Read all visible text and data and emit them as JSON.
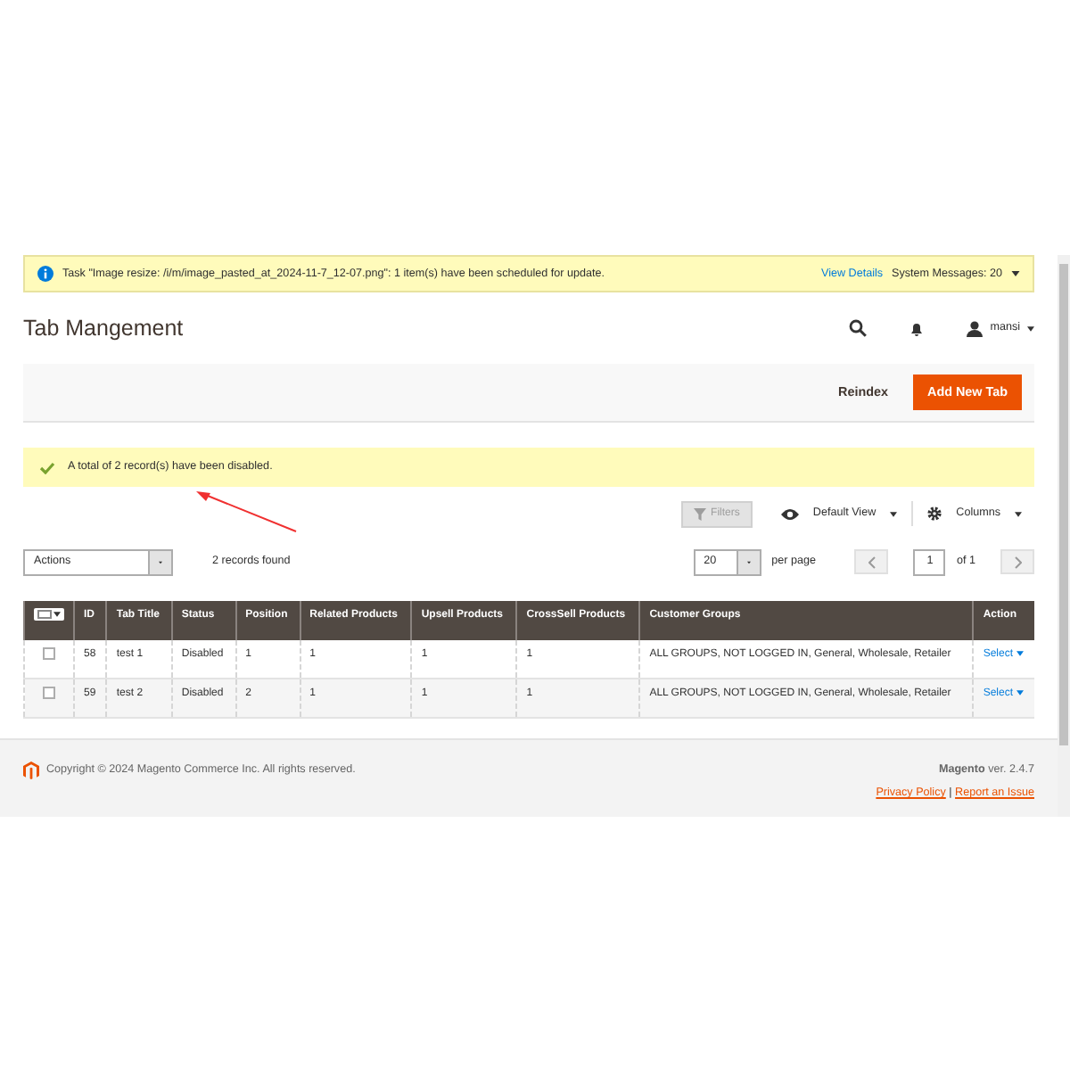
{
  "notice": {
    "text": "Task \"Image resize: /i/m/image_pasted_at_2024-11-7_12-07.png\": 1 item(s) have been scheduled for update.",
    "link": "View Details",
    "system_messages": "System Messages: 20"
  },
  "header": {
    "title": "Tab Mangement",
    "user": "mansi"
  },
  "page_actions": {
    "secondary": "Reindex",
    "primary": "Add New Tab"
  },
  "message": {
    "text": "A total of 2 record(s) have been disabled."
  },
  "toolbar": {
    "filters": "Filters",
    "filters_disabled": true,
    "view": "Default View",
    "columns": "Columns"
  },
  "grid": {
    "mass_action": "Actions",
    "records": "2 records found",
    "per_page_value": "20",
    "per_page_label": "per page",
    "page": "1",
    "page_total": "of 1"
  },
  "table": {
    "mass_select_checked": false,
    "columns": [
      "ID",
      "Tab Title",
      "Status",
      "Position",
      "Related Products",
      "Upsell Products",
      "CrossSell Products",
      "Customer Groups",
      "Action"
    ],
    "rows": [
      {
        "checked": false,
        "cells": [
          "58",
          "test 1",
          "Disabled",
          "1",
          "1",
          "1",
          "1",
          "ALL GROUPS, NOT LOGGED IN, General, Wholesale, Retailer"
        ],
        "action": "Select"
      },
      {
        "checked": false,
        "cells": [
          "59",
          "test 2",
          "Disabled",
          "2",
          "1",
          "1",
          "1",
          "ALL GROUPS, NOT LOGGED IN, General, Wholesale, Retailer"
        ],
        "action": "Select"
      }
    ]
  },
  "footer": {
    "copyright": "Copyright © 2024 Magento Commerce Inc. All rights reserved.",
    "brand": "Magento",
    "version": "ver. 2.4.7",
    "links": [
      "Privacy Policy",
      "Report an Issue"
    ],
    "separator": "|"
  }
}
